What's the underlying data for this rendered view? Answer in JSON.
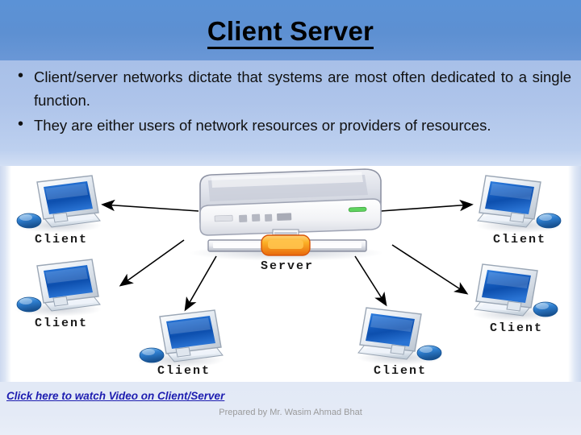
{
  "slide": {
    "title": "Client Server",
    "bullets": [
      "Client/server networks dictate that systems are most often dedicated to a single function.",
      "They are either users of network resources or providers of resources."
    ]
  },
  "diagram": {
    "server_label": "Server",
    "client_labels": [
      "Client",
      "Client",
      "Client",
      "Client",
      "Client",
      "Client"
    ],
    "arrow_count": 6
  },
  "footer": {
    "video_link": "Click here to watch Video on Client/Server",
    "credit": "Prepared by Mr. Wasim Ahmad Bhat"
  },
  "colors": {
    "title_band": "#5d90d2",
    "text_band": "#aec4ea",
    "footer_band": "#e4eaf6",
    "link": "#1d1db0",
    "credit": "#9a9a9a",
    "screen_blue": "#1b66c9",
    "server_led": "#5fd35f",
    "server_connector": "#f59a12"
  }
}
